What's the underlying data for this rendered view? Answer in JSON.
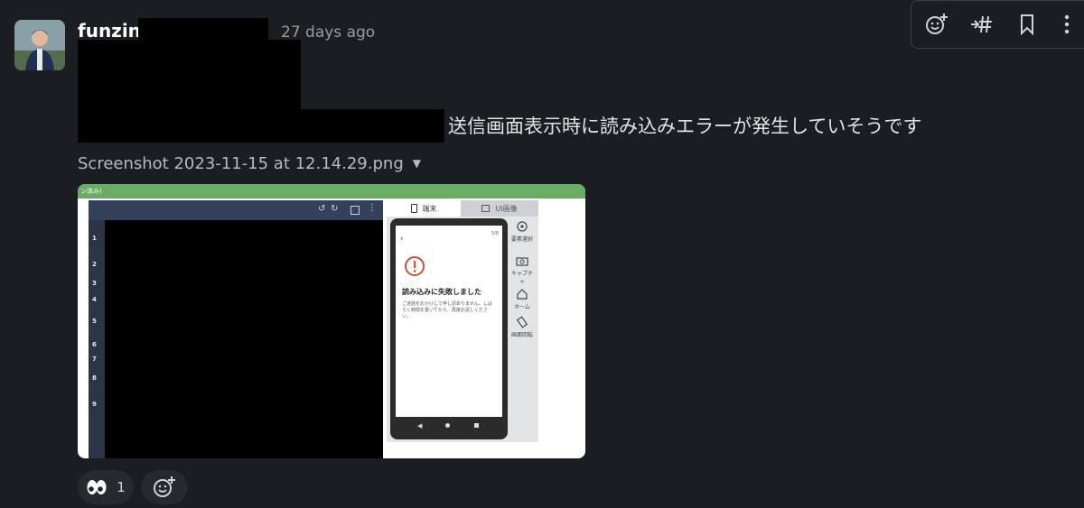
{
  "message": {
    "username": "funzin",
    "timestamp": "27 days ago",
    "text": "送信画面表示時に読み込みエラーが発生していそうです",
    "attachment": {
      "filename": "Screenshot 2023-11-15 at 12.14.29.png",
      "preview": {
        "header_fragment": "ン済み)",
        "tabs": [
          "端末",
          "UI画像"
        ],
        "row_numbers": [
          "1",
          "2",
          "3",
          "4",
          "5",
          "6",
          "7",
          "8",
          "9"
        ],
        "phone": {
          "status_right": "5/8",
          "error_title": "読み込みに失敗しました",
          "error_body": "ご迷惑をおかけして申し訳ありません。しばらく時間を置いてから、再度お試しください。"
        },
        "side_tools": [
          "要素選択",
          "キャプチャ",
          "ホーム",
          "画面回転"
        ]
      }
    },
    "reactions": [
      {
        "emoji": "👀",
        "count": "1"
      }
    ]
  },
  "toolbar": {
    "icons": [
      "add-reaction-icon",
      "forward-to-channel-icon",
      "bookmark-icon",
      "more-actions-icon"
    ]
  },
  "colors": {
    "background": "#1a1d21",
    "preview_header": "#6aab66",
    "reaction_bg": "#26292e"
  }
}
